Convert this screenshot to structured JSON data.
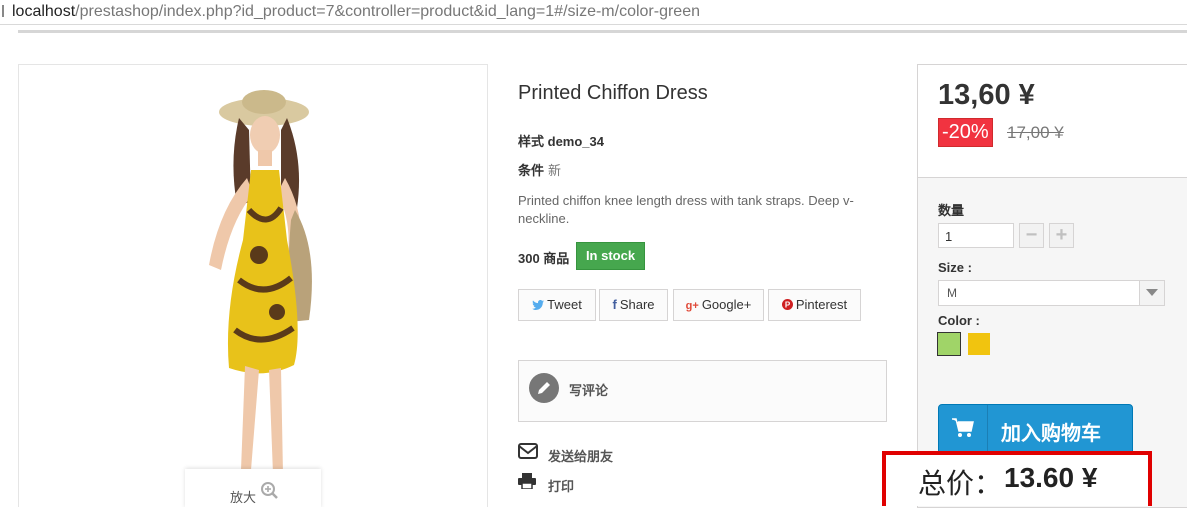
{
  "browser": {
    "url_host": "localhost",
    "url_path": "/prestashop/index.php?id_product=7&controller=product&id_lang=1#/size-m/color-green"
  },
  "image": {
    "zoom_label": "放大"
  },
  "product": {
    "title": "Printed Chiffon Dress",
    "reference_label": "样式",
    "reference_value": "demo_34",
    "condition_label": "条件",
    "condition_value": "新",
    "description": "Printed chiffon knee length dress with tank straps. Deep v-neckline.",
    "quantity_text": "300 商品",
    "stock_badge": "In stock",
    "stock_color": "#46a74e"
  },
  "social": [
    {
      "icon": "twitter-icon",
      "label": "Tweet",
      "icon_glyph": "🐦"
    },
    {
      "icon": "facebook-icon",
      "label": "Share",
      "icon_glyph": "f"
    },
    {
      "icon": "google-plus-icon",
      "label": "Google+",
      "icon_glyph": "g+"
    },
    {
      "icon": "pinterest-icon",
      "label": "Pinterest",
      "icon_glyph": "P"
    }
  ],
  "review": {
    "label": "写评论"
  },
  "links": {
    "send_friend": "发送给朋友",
    "print": "打印"
  },
  "buy": {
    "price": "13,60 ¥",
    "discount": "-20%",
    "old_price": "17,00 ¥",
    "quantity_label": "数量",
    "quantity_value": "1",
    "minus_glyph": "−",
    "plus_glyph": "+",
    "size_label": "Size :",
    "size_selected": "M",
    "color_label": "Color :",
    "colors": [
      {
        "name": "Green",
        "hex": "#a0d468",
        "selected": true
      },
      {
        "name": "Yellow",
        "hex": "#f1c40f",
        "selected": false
      }
    ],
    "add_to_cart": "加入购物车",
    "accent": "#2196d3",
    "discount_color": "#f13340"
  },
  "total": {
    "label": "总价：",
    "value": "13.60 ¥",
    "highlight_color": "#e00000"
  }
}
